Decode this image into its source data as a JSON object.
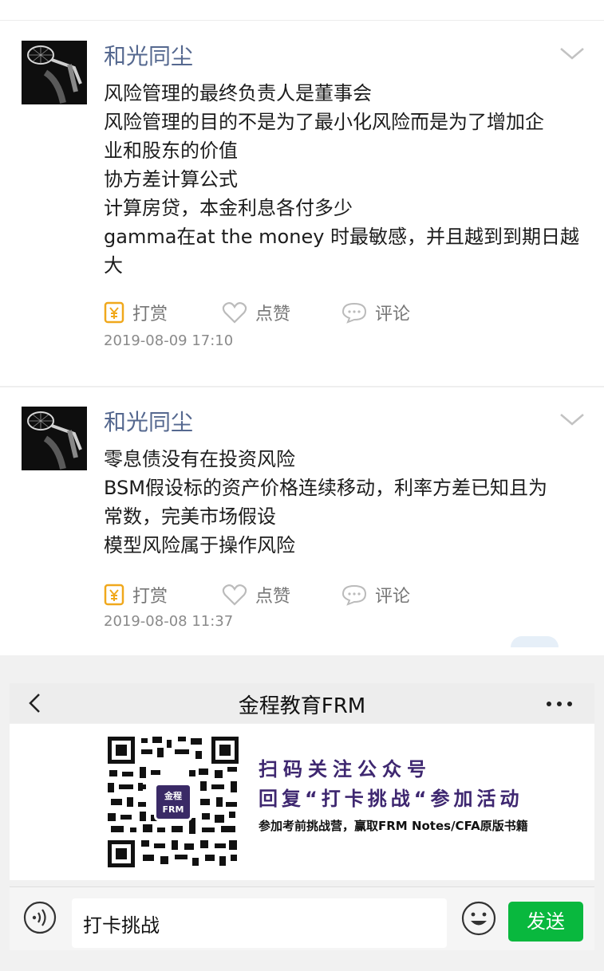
{
  "posts": [
    {
      "author": "和光同尘",
      "lines": [
        "风险管理的最终负责人是董事会",
        "风险管理的目的不是为了最小化风险而是为了增加企",
        "业和股东的价值",
        "协方差计算公式",
        "计算房贷，本金利息各付多少",
        "gamma在at the money 时最敏感，并且越到到期日越",
        "大"
      ],
      "actions": {
        "reward": "打赏",
        "like": "点赞",
        "comment": "评论"
      },
      "time": "2019-08-09 17:10"
    },
    {
      "author": "和光同尘",
      "lines": [
        "零息债没有在投资风险",
        "BSM假设标的资产价格连续移动，利率方差已知且为",
        "常数，完美市场假设",
        "模型风险属于操作风险"
      ],
      "actions": {
        "reward": "打赏",
        "like": "点赞",
        "comment": "评论"
      },
      "time": "2019-08-08 11:37"
    }
  ],
  "chat": {
    "title": "金程教育FRM",
    "qr_logo_line1": "金程",
    "qr_logo_line2": "FRM",
    "promo_line1": "扫码关注公众号",
    "promo_line2": "回复“打卡挑战“参加活动",
    "promo_line3": "参加考前挑战营，赢取FRM Notes/CFA原版书籍",
    "input_value": "打卡挑战",
    "send_label": "发送"
  },
  "icons": {
    "back": "chevron-left-icon",
    "more": "more-dots-icon",
    "collapse": "chevron-down-icon",
    "reward": "yuan-reward-icon",
    "like": "heart-icon",
    "comment": "comment-icon",
    "voice": "voice-icon",
    "emoji": "emoji-icon"
  },
  "colors": {
    "author": "#55688f",
    "send_button": "#09b83e",
    "promo_text": "#3e2770",
    "reward_icon": "#f0a81c"
  }
}
